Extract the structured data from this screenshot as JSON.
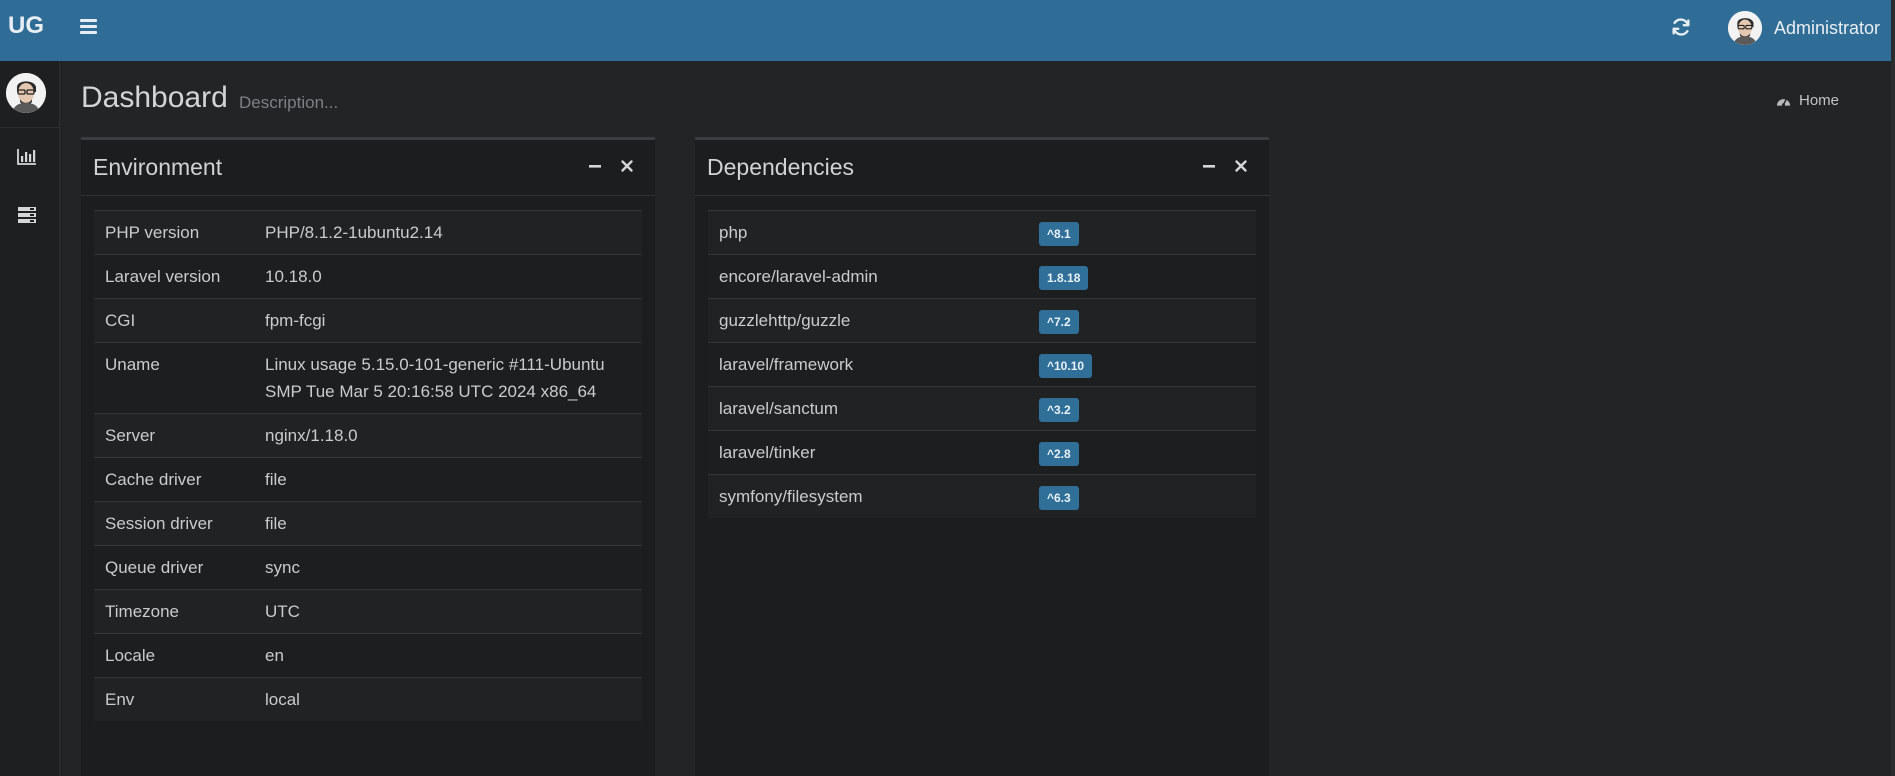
{
  "header": {
    "logo": "UG",
    "user_name": "Administrator"
  },
  "sidebar": {
    "items": [
      {
        "icon": "bar-chart-icon"
      },
      {
        "icon": "server-icon"
      }
    ]
  },
  "page": {
    "title": "Dashboard",
    "description": "Description...",
    "breadcrumb": "Home"
  },
  "environment": {
    "title": "Environment",
    "rows": [
      {
        "key": "PHP version",
        "value": "PHP/8.1.2-1ubuntu2.14"
      },
      {
        "key": "Laravel version",
        "value": "10.18.0"
      },
      {
        "key": "CGI",
        "value": "fpm-fcgi"
      },
      {
        "key": "Uname",
        "value": "Linux usage 5.15.0-101-generic #111-Ubuntu SMP Tue Mar 5 20:16:58 UTC 2024 x86_64"
      },
      {
        "key": "Server",
        "value": "nginx/1.18.0"
      },
      {
        "key": "Cache driver",
        "value": "file"
      },
      {
        "key": "Session driver",
        "value": "file"
      },
      {
        "key": "Queue driver",
        "value": "sync"
      },
      {
        "key": "Timezone",
        "value": "UTC"
      },
      {
        "key": "Locale",
        "value": "en"
      },
      {
        "key": "Env",
        "value": "local"
      }
    ]
  },
  "dependencies": {
    "title": "Dependencies",
    "rows": [
      {
        "name": "php",
        "version": "^8.1"
      },
      {
        "name": "encore/laravel-admin",
        "version": "1.8.18"
      },
      {
        "name": "guzzlehttp/guzzle",
        "version": "^7.2"
      },
      {
        "name": "laravel/framework",
        "version": "^10.10"
      },
      {
        "name": "laravel/sanctum",
        "version": "^3.2"
      },
      {
        "name": "laravel/tinker",
        "version": "^2.8"
      },
      {
        "name": "symfony/filesystem",
        "version": "^6.3"
      }
    ]
  },
  "colors": {
    "header_bg": "#306d96",
    "badge_bg": "#2f6f98",
    "page_bg": "#222426"
  }
}
